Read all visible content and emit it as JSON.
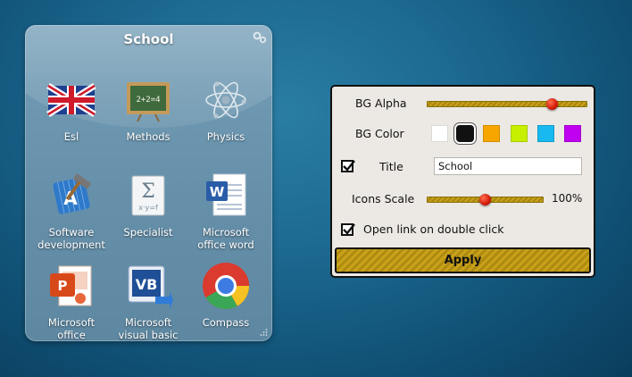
{
  "widget": {
    "title": "School",
    "icons": [
      {
        "label": "Esl",
        "icon": "uk-flag-icon"
      },
      {
        "label": "Methods",
        "icon": "chalkboard-icon"
      },
      {
        "label": "Physics",
        "icon": "atom-icon"
      },
      {
        "label_line1": "Software",
        "label_line2": "development",
        "icon": "xcode-hammer-icon"
      },
      {
        "label": "Specialist",
        "icon": "sigma-sheet-icon"
      },
      {
        "label_line1": "Microsoft",
        "label_line2": "office word",
        "icon": "ms-word-icon"
      },
      {
        "label_line1": "Microsoft",
        "label_line2": "office",
        "icon": "ms-powerpoint-icon"
      },
      {
        "label_line1": "Microsoft",
        "label_line2": "visual basic",
        "icon": "visual-basic-icon"
      },
      {
        "label": "Compass",
        "icon": "chrome-icon"
      }
    ]
  },
  "settings": {
    "bg_alpha_label": "BG Alpha",
    "bg_alpha_value": 0.8,
    "bg_color_label": "BG Color",
    "bg_colors": [
      "#ffffff",
      "#111111",
      "#f7a600",
      "#c6f000",
      "#18b8f0",
      "#c000f0"
    ],
    "bg_color_selected": "#111111",
    "title_checked": true,
    "title_label": "Title",
    "title_value": "School",
    "icons_scale_label": "Icons Scale",
    "icons_scale_value_text": "100%",
    "icons_scale_value": 0.5,
    "open_link_checked": true,
    "open_link_label": "Open link on double click",
    "apply_label": "Apply"
  },
  "colors": {
    "accent_gold": "#c9a11a",
    "knob_red": "#d21a0a"
  }
}
